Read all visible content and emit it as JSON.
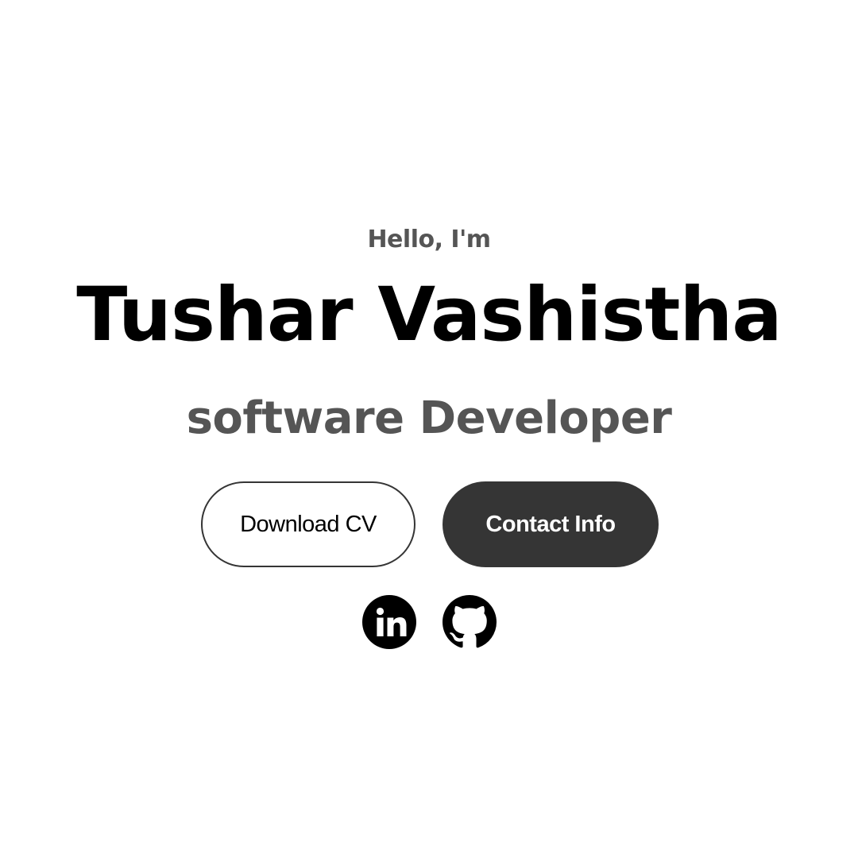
{
  "hero": {
    "greeting": "Hello, I'm",
    "name": "Tushar Vashistha",
    "role": "software Developer"
  },
  "buttons": {
    "download_cv_label": "Download CV",
    "contact_info_label": "Contact Info"
  },
  "social": {
    "linkedin_icon": "linkedin-icon",
    "github_icon": "github-icon"
  },
  "colors": {
    "dark_button": "#353535",
    "muted_text": "#555555",
    "heading_text": "#000000"
  }
}
